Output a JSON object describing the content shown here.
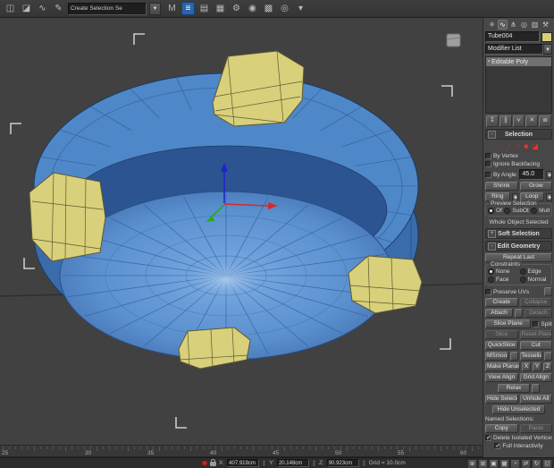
{
  "colors": {
    "accent_blue": "#2d64a8",
    "model_blue_top": "#4f88c9",
    "model_blue_side": "#3a6cab",
    "model_blue_dark": "#2b5490",
    "model_blue_floor_hi": "#79aae2",
    "model_blue_floor_lo": "#416fae",
    "model_blue_line": "#2d5c9a",
    "model_outline": "#1c3a63",
    "model_yellow": "#d8d07b",
    "model_yellow_line": "#5e5830",
    "bracket": "#e8e8e8",
    "gizmo_x": "#d62b2b",
    "gizmo_y": "#27a827",
    "gizmo_z": "#2222cc"
  },
  "toolbar": {
    "selection_set_value": "Create Selection Se",
    "left_icons": [
      {
        "name": "select-and-link-icon",
        "glyph": "◫"
      },
      {
        "name": "unlink-selection-icon",
        "glyph": "◪"
      },
      {
        "name": "bind-to-space-warp-icon",
        "glyph": "∿"
      },
      {
        "name": "edit-named-selection-sets-icon",
        "glyph": "✎"
      }
    ],
    "right_icons": [
      {
        "name": "mirror-icon",
        "glyph": "M"
      },
      {
        "name": "align-icon",
        "glyph": "≡",
        "active": true
      },
      {
        "name": "layer-manager-icon",
        "glyph": "▤"
      },
      {
        "name": "scene-explorer-icon",
        "glyph": "▦"
      },
      {
        "name": "snaps-toggle-icon",
        "glyph": "⚙"
      },
      {
        "name": "material-editor-icon",
        "glyph": "◉"
      },
      {
        "name": "render-setup-icon",
        "glyph": "▩"
      },
      {
        "name": "render-icon",
        "glyph": "◎"
      },
      {
        "name": "flyout-arrow-icon",
        "glyph": "▾"
      }
    ]
  },
  "panel": {
    "tabs": [
      {
        "name": "create-tab",
        "glyph": "✳"
      },
      {
        "name": "modify-tab",
        "glyph": "∿",
        "active": true
      },
      {
        "name": "hierarchy-tab",
        "glyph": "⋔"
      },
      {
        "name": "motion-tab",
        "glyph": "◎"
      },
      {
        "name": "display-tab",
        "glyph": "▥"
      },
      {
        "name": "utilities-tab",
        "glyph": "⚒"
      }
    ],
    "object_name": "Tube004",
    "modifier_list_label": "Modifier List",
    "stack_items": [
      {
        "label": "Editable Poly",
        "selected": true
      }
    ],
    "stack_tools": [
      {
        "name": "pin-stack-icon",
        "glyph": "↧"
      },
      {
        "name": "show-end-result-icon",
        "glyph": "∥"
      },
      {
        "name": "make-unique-icon",
        "glyph": "⋎"
      },
      {
        "name": "remove-modifier-icon",
        "glyph": "✕"
      },
      {
        "name": "configure-modifier-sets-icon",
        "glyph": "≣"
      }
    ],
    "selection": {
      "state": "-",
      "title": "Selection",
      "subobject_icons": [
        {
          "name": "vertex-icon",
          "glyph": "∴"
        },
        {
          "name": "edge-icon",
          "glyph": "╱"
        },
        {
          "name": "border-icon",
          "glyph": "◇"
        },
        {
          "name": "polygon-icon",
          "glyph": "■",
          "bright": true
        },
        {
          "name": "element-icon",
          "glyph": "◪",
          "bright": true
        }
      ],
      "by_vertex": "By Vertex",
      "ignore_backfacing": "Ignore Backfacing",
      "by_angle": "By Angle:",
      "by_angle_value": "45.0",
      "shrink": "Shrink",
      "grow": "Grow",
      "ring": "Ring",
      "loop": "Loop",
      "preview_title": "Preview Selection",
      "preview_off": "Off",
      "preview_subobj": "SubObj",
      "preview_multi": "Multi",
      "status": "Whole Object Selected"
    },
    "soft_selection": {
      "state": "+",
      "title": "Soft Selection"
    },
    "edit_geometry": {
      "state": "-",
      "title": "Edit Geometry",
      "repeat_last": "Repeat Last",
      "constraints_title": "Constraints",
      "c_none": "None",
      "c_edge": "Edge",
      "c_face": "Face",
      "c_normal": "Normal",
      "preserve_uvs": "Preserve UVs",
      "create": "Create",
      "collapse": "Collapse",
      "attach": "Attach",
      "detach": "Detach",
      "slice_plane": "Slice Plane",
      "split": "Split",
      "slice": "Slice",
      "reset_plane": "Reset Plane",
      "quickslice": "QuickSlice",
      "cut": "Cut",
      "msmooth": "MSmooth",
      "tessellate": "Tessellate",
      "make_planar": "Make Planar",
      "ax_x": "X",
      "ax_y": "Y",
      "ax_z": "Z",
      "view_align": "View Align",
      "grid_align": "Grid Align",
      "relax": "Relax",
      "hide_selected": "Hide Selected",
      "unhide_all": "Unhide All",
      "hide_unselected": "Hide Unselected",
      "named_selections": "Named Selections:",
      "copy": "Copy",
      "paste": "Paste",
      "delete_isolated": "Delete Isolated Vertices",
      "full_interactivity": "Full Interactivity"
    }
  },
  "timeline": {
    "labels": [
      "25",
      "30",
      "35",
      "40",
      "45",
      "50",
      "55",
      "60"
    ]
  },
  "statusbar": {
    "x_label": "X:",
    "x_value": "407.919cm",
    "y_label": "Y:",
    "y_value": "20.148cm",
    "z_label": "Z:",
    "z_value": "90.923cm",
    "grid_label": "Grid = 10.0cm",
    "nav_icons": [
      {
        "name": "zoom-icon",
        "glyph": "⊕"
      },
      {
        "name": "zoom-all-icon",
        "glyph": "⊞"
      },
      {
        "name": "zoom-extents-icon",
        "glyph": "▣"
      },
      {
        "name": "zoom-extents-all-icon",
        "glyph": "▦"
      },
      {
        "name": "field-of-view-icon",
        "glyph": "◔"
      },
      {
        "name": "pan-icon",
        "glyph": "⇄"
      },
      {
        "name": "orbit-icon",
        "glyph": "↻"
      },
      {
        "name": "maximize-viewport-icon",
        "glyph": "◱"
      }
    ]
  }
}
